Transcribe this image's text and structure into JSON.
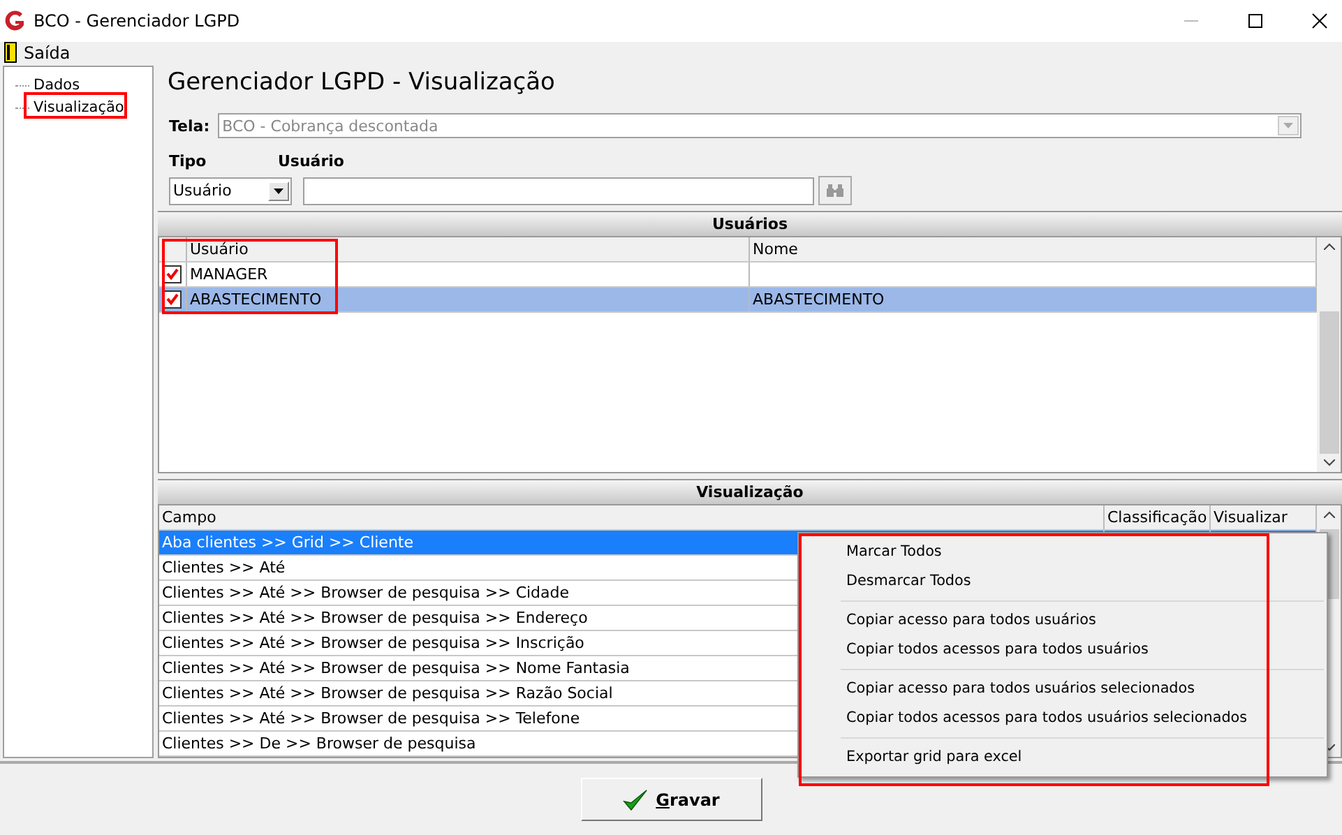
{
  "window": {
    "title": "BCO - Gerenciador LGPD"
  },
  "menu": [
    {
      "label": "Saída"
    }
  ],
  "tree": [
    {
      "label": "Dados"
    },
    {
      "label": "Visualização"
    }
  ],
  "heading": "Gerenciador LGPD - Visualização",
  "tela": {
    "label": "Tela:",
    "value": "BCO - Cobrança descontada",
    "disabled": true
  },
  "tipo": {
    "label": "Tipo",
    "value": "Usuário"
  },
  "usuario": {
    "label": "Usuário"
  },
  "usuarios": {
    "title": "Usuários",
    "columns": [
      "Usuário",
      "Nome"
    ],
    "rows": [
      {
        "checked": true,
        "selected": false,
        "usuario": "MANAGER"
      },
      {
        "checked": true,
        "selected": true,
        "usuario": "ABASTECIMENTO",
        "nome": "ABASTECIMENTO"
      }
    ]
  },
  "visualizacao": {
    "title": "Visualização",
    "columns": [
      "Campo",
      "Classificação",
      "Visualizar"
    ],
    "rows": [
      {
        "campo": "Aba clientes >> Grid >> Cliente",
        "selected": true
      },
      {
        "campo": "Clientes >> Até",
        "selected": false
      },
      {
        "campo": "Clientes >> Até  >> Browser de pesquisa >> Cidade",
        "selected": false
      },
      {
        "campo": "Clientes >> Até  >> Browser de pesquisa >> Endereço",
        "selected": false
      },
      {
        "campo": "Clientes >> Até  >> Browser de pesquisa >> Inscrição",
        "selected": false
      },
      {
        "campo": "Clientes >> Até  >> Browser de pesquisa >> Nome Fantasia",
        "selected": false
      },
      {
        "campo": "Clientes >> Até  >> Browser de pesquisa >> Razão Social",
        "selected": false
      },
      {
        "campo": "Clientes >> Até  >> Browser de pesquisa >> Telefone",
        "selected": false
      },
      {
        "campo": "Clientes >> De >> Browser de pesquisa",
        "selected": false
      }
    ]
  },
  "context_menu": {
    "groups": [
      {
        "items": [
          "Marcar Todos",
          "Desmarcar Todos"
        ]
      },
      {
        "items": [
          "Copiar acesso para todos usuários",
          "Copiar todos acessos para todos usuários"
        ]
      },
      {
        "items": [
          "Copiar acesso para todos usuários selecionados",
          "Copiar todos acessos para todos usuários selecionados"
        ]
      },
      {
        "items": [
          "Exportar grid para excel"
        ]
      }
    ]
  },
  "save_button": {
    "label": "Gravar"
  }
}
